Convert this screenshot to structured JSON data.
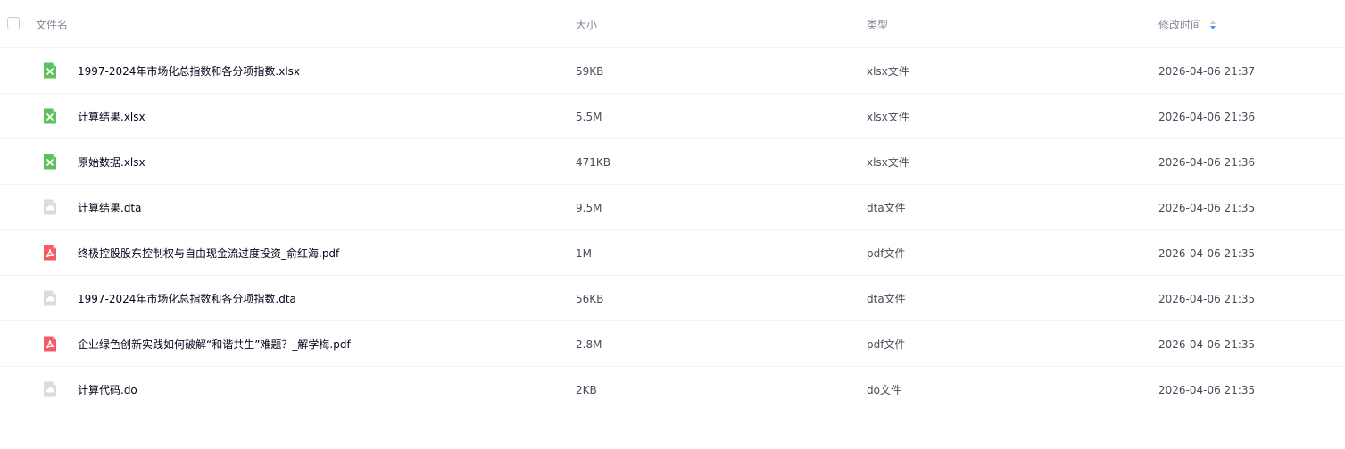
{
  "header": {
    "name_label": "文件名",
    "size_label": "大小",
    "type_label": "类型",
    "time_label": "修改时间"
  },
  "colors": {
    "xlsx_icon": "#5fc15b",
    "pdf_icon": "#f45b64",
    "generic_icon": "#d9dbe0",
    "sort_active": "#2f9bff",
    "sort_inactive": "#c8cbd2"
  },
  "files": [
    {
      "icon": "excel-icon",
      "name": "1997-2024年市场化总指数和各分项指数.xlsx",
      "size": "59KB",
      "type": "xlsx文件",
      "time": "2026-04-06 21:37"
    },
    {
      "icon": "excel-icon",
      "name": "计算结果.xlsx",
      "size": "5.5M",
      "type": "xlsx文件",
      "time": "2026-04-06 21:36"
    },
    {
      "icon": "excel-icon",
      "name": "原始数据.xlsx",
      "size": "471KB",
      "type": "xlsx文件",
      "time": "2026-04-06 21:36"
    },
    {
      "icon": "cloud-file-icon",
      "name": "计算结果.dta",
      "size": "9.5M",
      "type": "dta文件",
      "time": "2026-04-06 21:35"
    },
    {
      "icon": "pdf-icon",
      "name": "终极控股股东控制权与自由现金流过度投资_俞红海.pdf",
      "size": "1M",
      "type": "pdf文件",
      "time": "2026-04-06 21:35"
    },
    {
      "icon": "cloud-file-icon",
      "name": "1997-2024年市场化总指数和各分项指数.dta",
      "size": "56KB",
      "type": "dta文件",
      "time": "2026-04-06 21:35"
    },
    {
      "icon": "pdf-icon",
      "name": "企业绿色创新实践如何破解“和谐共生”难题？_解学梅.pdf",
      "size": "2.8M",
      "type": "pdf文件",
      "time": "2026-04-06 21:35"
    },
    {
      "icon": "cloud-file-icon",
      "name": "计算代码.do",
      "size": "2KB",
      "type": "do文件",
      "time": "2026-04-06 21:35"
    }
  ]
}
